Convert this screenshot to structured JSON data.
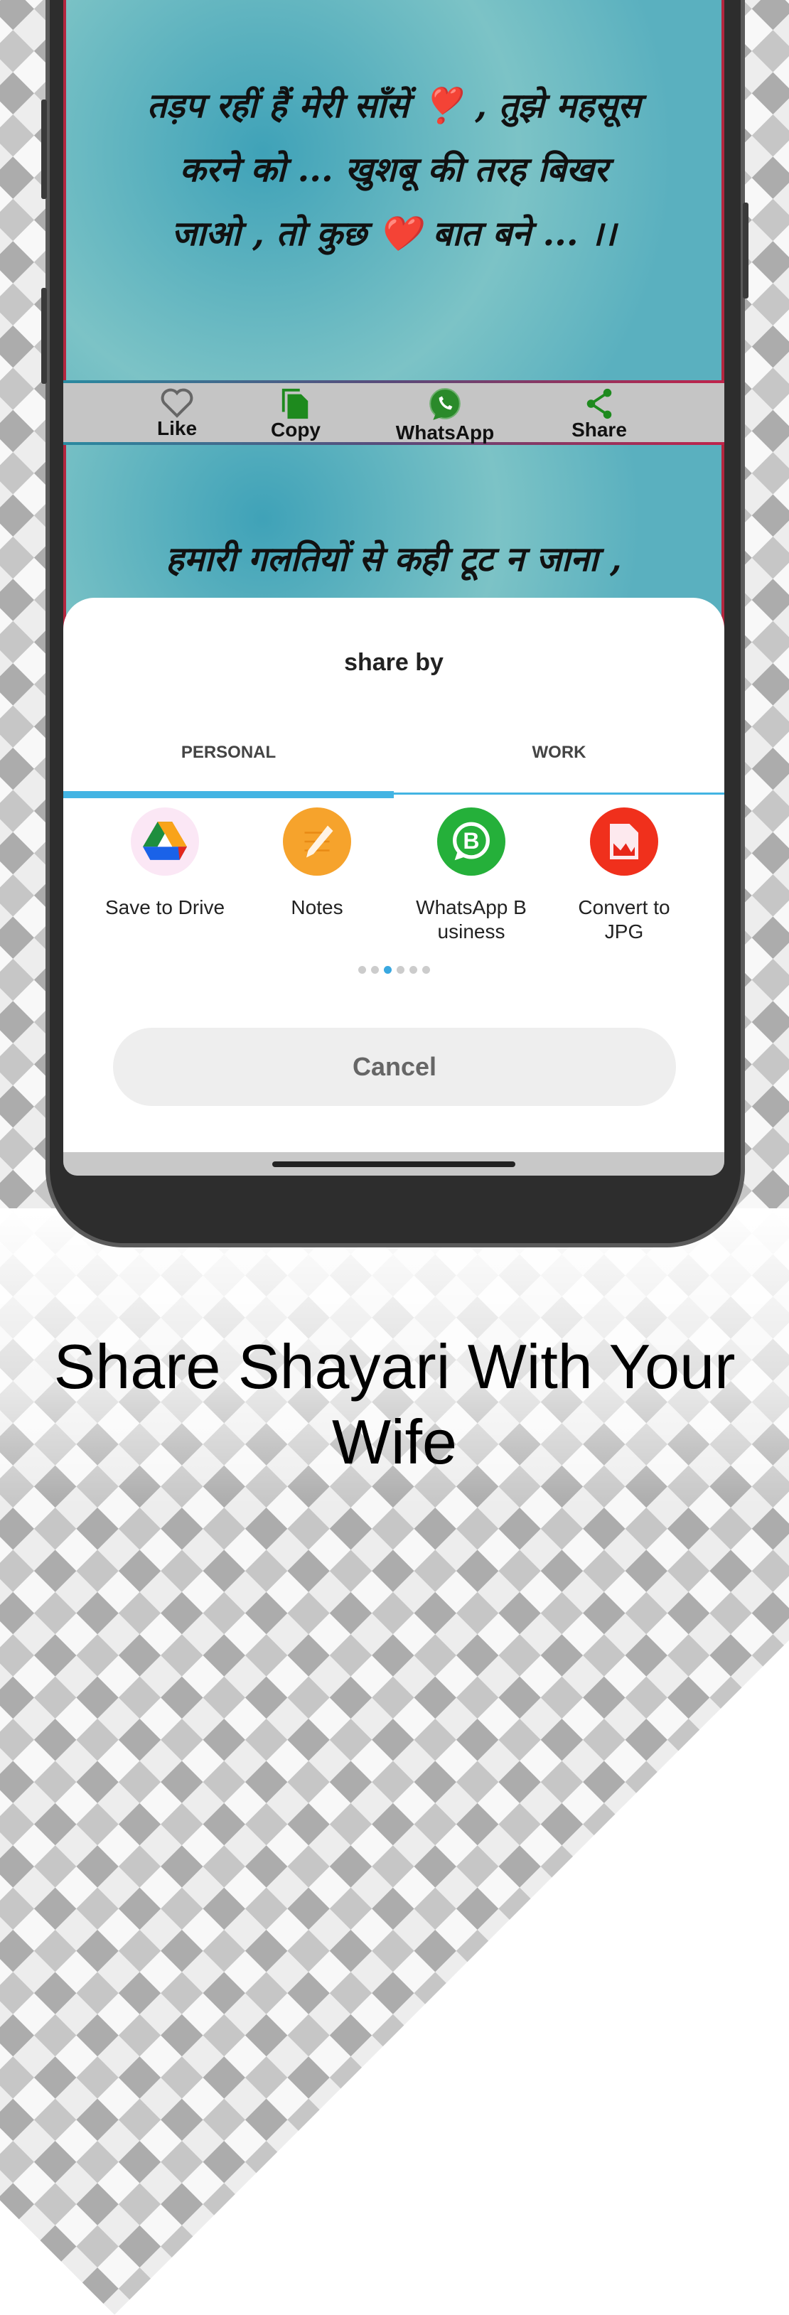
{
  "quotes": [
    {
      "lines": [
        "तड़प रहीं हैं मेरी साँसें ❣️ , तुझे महसूस",
        "करने को ... खुशबू की तरह बिखर",
        "जाओ , तो कुछ ❤️ बात बने ... ।।"
      ]
    },
    {
      "lines": [
        "हमारी गलतियों से कही टूट न जाना ,"
      ]
    }
  ],
  "action_bar": [
    {
      "label": "Like",
      "icon": "heart-outline-icon",
      "color": "#666666"
    },
    {
      "label": "Copy",
      "icon": "copy-icon",
      "color": "#1e8a1e"
    },
    {
      "label": "WhatsApp",
      "icon": "whatsapp-icon",
      "color": "#1e8a1e"
    },
    {
      "label": "Share",
      "icon": "share-icon",
      "color": "#1e8a1e"
    }
  ],
  "share_sheet": {
    "title": "share by",
    "tabs": [
      {
        "label": "PERSONAL",
        "active": true
      },
      {
        "label": "WORK",
        "active": false
      }
    ],
    "apps": [
      {
        "label": "Save to Drive",
        "icon": "google-drive-icon"
      },
      {
        "label": "Notes",
        "icon": "notes-icon"
      },
      {
        "label": "WhatsApp B usiness",
        "icon": "whatsapp-business-icon"
      },
      {
        "label": "Convert to JPG",
        "icon": "convert-jpg-icon"
      }
    ],
    "page_count": 6,
    "current_page": 3,
    "cancel_label": "Cancel",
    "accent": "#43b4e3"
  },
  "caption": {
    "line1": "Share Shayari With Your",
    "line2": "Wife"
  }
}
